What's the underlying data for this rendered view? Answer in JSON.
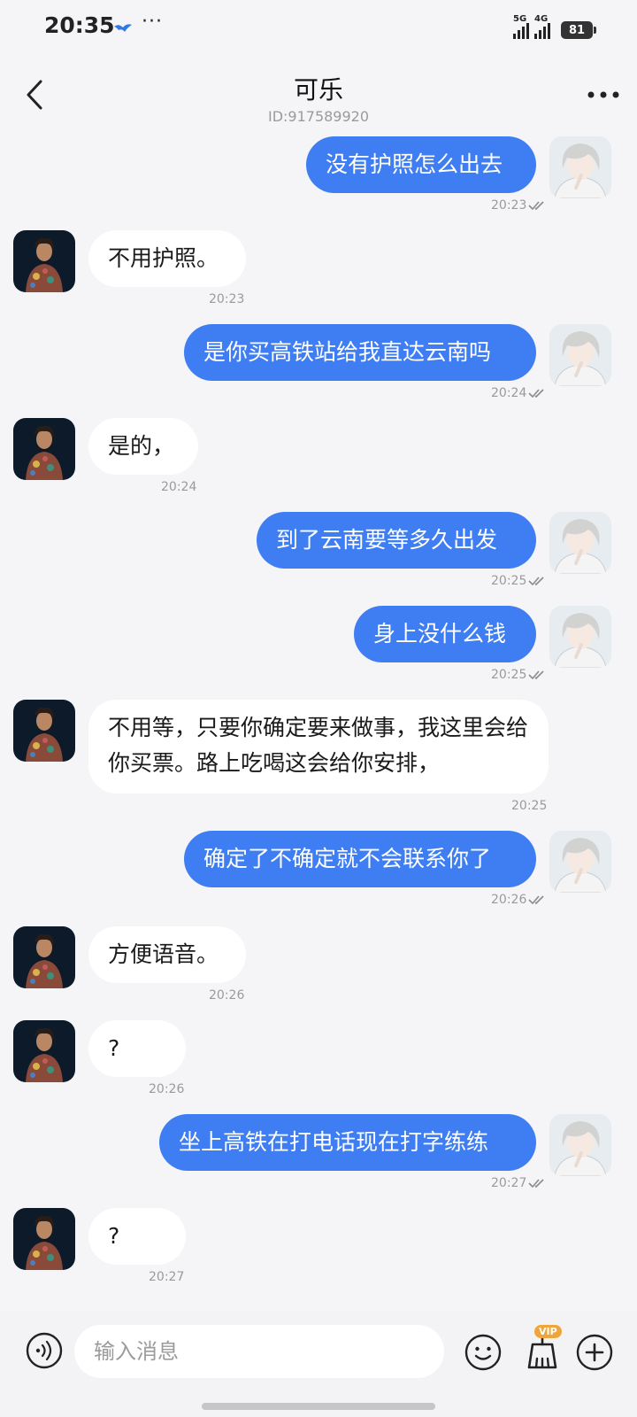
{
  "status_bar": {
    "time": "20:35",
    "dots": "···",
    "net1": "5G",
    "net2": "4G",
    "battery": "81"
  },
  "header": {
    "title": "可乐",
    "subtitle": "ID:917589920"
  },
  "messages": [
    {
      "from": "me",
      "text": "没有护照怎么出去",
      "time": "20:23"
    },
    {
      "from": "them",
      "text": "不用护照。",
      "time": "20:23"
    },
    {
      "from": "me",
      "text": "是你买高铁站给我直达云南吗",
      "time": "20:24"
    },
    {
      "from": "them",
      "text": "是的，",
      "time": "20:24"
    },
    {
      "from": "me",
      "text": "到了云南要等多久出发",
      "time": "20:25"
    },
    {
      "from": "me",
      "text": "身上没什么钱",
      "time": "20:25"
    },
    {
      "from": "them",
      "text": "不用等，只要你确定要来做事，我这里会给你买票。路上吃喝这会给你安排，",
      "time": "20:25"
    },
    {
      "from": "me",
      "text": "确定了不确定就不会联系你了",
      "time": "20:26"
    },
    {
      "from": "them",
      "text": "方便语音。",
      "time": "20:26"
    },
    {
      "from": "them",
      "text": "?",
      "time": "20:26"
    },
    {
      "from": "me",
      "text": "坐上高铁在打电话现在打字练练",
      "time": "20:27"
    },
    {
      "from": "them",
      "text": "?",
      "time": "20:27"
    }
  ],
  "input": {
    "placeholder": "输入消息",
    "vip_label": "VIP"
  },
  "icons": {
    "back": "back-arrow-icon",
    "more": "more-dots-icon",
    "voice": "voice-icon",
    "emoji": "emoji-icon",
    "broom": "broom-icon",
    "plus": "plus-icon",
    "read": "double-check-icon"
  },
  "colors": {
    "my_bubble": "#3f7ef2",
    "their_bubble": "#ffffff",
    "background": "#f5f5f7"
  }
}
